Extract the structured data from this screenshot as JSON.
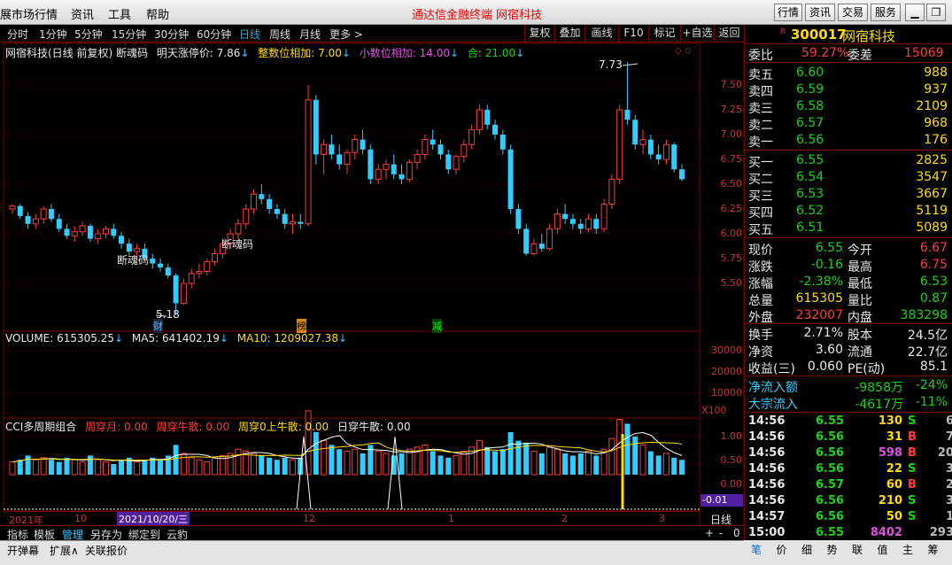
{
  "titlebar": {
    "menu": [
      "展市场行情",
      "资讯",
      "工具",
      "帮助"
    ],
    "center_title": "通达信金融终端",
    "center_stock": "网宿科技",
    "buttons": [
      "行情",
      "资讯",
      "交易",
      "服务"
    ]
  },
  "timeframes": [
    "分时",
    "1分钟",
    "5分钟",
    "15分钟",
    "30分钟",
    "60分钟",
    "日线",
    "周线",
    "月线",
    "更多 >"
  ],
  "active_timeframe": "日线",
  "chart_buttons": [
    "复权",
    "叠加",
    "画线",
    "F10",
    "标记",
    "+自选",
    "返回"
  ],
  "main_indicator": {
    "title": "网宿科技(日线 前复权) 断魂码",
    "next_limit_label": "明天涨停价: 7.86",
    "int_label": "整数位相加: 7.00",
    "dec_label": "小数位相加: 14.00",
    "sum_label": "合: 21.00"
  },
  "annotations": {
    "high": "7.73",
    "low": "5.18",
    "duan1": "断魂码",
    "duan2": "断魂码",
    "cai": "财",
    "bang": "榜",
    "jian": "减"
  },
  "price_axis": [
    "7.50",
    "7.25",
    "7.00",
    "6.75",
    "6.50",
    "6.25",
    "6.00",
    "5.75",
    "5.50"
  ],
  "volume": {
    "label": "VOLUME: 615305.25",
    "ma5": "MA5: 641402.19",
    "ma10": "MA10: 1209027.38",
    "axis": [
      "30000",
      "20000",
      "10000"
    ],
    "unit": "X100"
  },
  "cci": {
    "label": "CCI多周期组合",
    "week_month": "周穿月: 0.00",
    "week_bull": "周穿牛散: 0.00",
    "week0": "周穿0上牛散: 0.00",
    "day_bull": "日穿牛散: 0.00",
    "axis": [
      "1.00",
      "0.50",
      "0.00"
    ],
    "current": "-0.01"
  },
  "date_axis": {
    "year": "2021年",
    "m10": "10",
    "cursor": "2021/10/20/三",
    "m12": "12",
    "m1": "1",
    "m2": "2",
    "m3": "3",
    "period": "日线"
  },
  "bottom_tabs": [
    "指标",
    "模板",
    "管理",
    "另存为",
    "绑定到",
    "云豹"
  ],
  "bottom_right": [
    "+",
    "-",
    "0"
  ],
  "status_buttons": [
    "开弹幕",
    "扩展∧",
    "关联报价"
  ],
  "quote": {
    "code": "300017",
    "name": "网宿科技",
    "weibi_label": "委比",
    "weibi": "59.27%",
    "weicha_label": "委差",
    "weicha": "15069",
    "asks": [
      {
        "label": "卖五",
        "price": "6.60",
        "vol": "988"
      },
      {
        "label": "卖四",
        "price": "6.59",
        "vol": "937"
      },
      {
        "label": "卖三",
        "price": "6.58",
        "vol": "2109"
      },
      {
        "label": "卖二",
        "price": "6.57",
        "vol": "968"
      },
      {
        "label": "卖一",
        "price": "6.56",
        "vol": "176"
      }
    ],
    "bids": [
      {
        "label": "买一",
        "price": "6.55",
        "vol": "2825"
      },
      {
        "label": "买二",
        "price": "6.54",
        "vol": "3547"
      },
      {
        "label": "买三",
        "price": "6.53",
        "vol": "3667"
      },
      {
        "label": "买四",
        "price": "6.52",
        "vol": "5119"
      },
      {
        "label": "买五",
        "price": "6.51",
        "vol": "5089"
      }
    ],
    "stats": [
      {
        "l1": "现价",
        "v1": "6.55",
        "c1": "green",
        "l2": "今开",
        "v2": "6.67",
        "c2": "red"
      },
      {
        "l1": "涨跌",
        "v1": "-0.16",
        "c1": "green",
        "l2": "最高",
        "v2": "6.75",
        "c2": "red"
      },
      {
        "l1": "涨幅",
        "v1": "-2.38%",
        "c1": "green",
        "l2": "最低",
        "v2": "6.53",
        "c2": "green"
      },
      {
        "l1": "总量",
        "v1": "615305",
        "c1": "yellow",
        "l2": "量比",
        "v2": "0.87",
        "c2": "green"
      },
      {
        "l1": "外盘",
        "v1": "232007",
        "c1": "red",
        "l2": "内盘",
        "v2": "383298",
        "c2": "green"
      }
    ],
    "stats2": [
      {
        "l1": "换手",
        "v1": "2.71%",
        "l2": "股本",
        "v2": "24.5亿"
      },
      {
        "l1": "净资",
        "v1": "3.60",
        "l2": "流通",
        "v2": "22.7亿"
      },
      {
        "l1": "收益(三)",
        "v1": "0.060",
        "l2": "PE(动)",
        "v2": "85.1"
      }
    ],
    "flow": [
      {
        "l": "净流入额",
        "v": "-9858万",
        "p": "-24%"
      },
      {
        "l": "大宗流入",
        "v": "-4617万",
        "p": "-11%"
      }
    ],
    "ticks": [
      {
        "t": "14:56",
        "p": "6.55",
        "v": "130",
        "s": "S",
        "n": "6",
        "pc": "green",
        "vc": "yellow",
        "sc": "green"
      },
      {
        "t": "14:56",
        "p": "6.56",
        "v": "31",
        "s": "B",
        "n": "7",
        "pc": "green",
        "vc": "yellow",
        "sc": "red"
      },
      {
        "t": "14:56",
        "p": "6.56",
        "v": "598",
        "s": "B",
        "n": "20",
        "pc": "green",
        "vc": "purple",
        "sc": "red"
      },
      {
        "t": "14:56",
        "p": "6.56",
        "v": "22",
        "s": "S",
        "n": "3",
        "pc": "green",
        "vc": "yellow",
        "sc": "green"
      },
      {
        "t": "14:56",
        "p": "6.57",
        "v": "60",
        "s": "B",
        "n": "2",
        "pc": "green",
        "vc": "yellow",
        "sc": "red"
      },
      {
        "t": "14:56",
        "p": "6.56",
        "v": "210",
        "s": "S",
        "n": "3",
        "pc": "green",
        "vc": "yellow",
        "sc": "green"
      },
      {
        "t": "14:57",
        "p": "6.56",
        "v": "50",
        "s": "S",
        "n": "1",
        "pc": "green",
        "vc": "yellow",
        "sc": "green"
      },
      {
        "t": "15:00",
        "p": "6.55",
        "v": "8402",
        "s": "",
        "n": "293",
        "pc": "green",
        "vc": "purple",
        "sc": "green"
      }
    ],
    "bottom_tabs": [
      "笔",
      "价",
      "细",
      "势",
      "联",
      "值",
      "主",
      "筹"
    ]
  }
}
